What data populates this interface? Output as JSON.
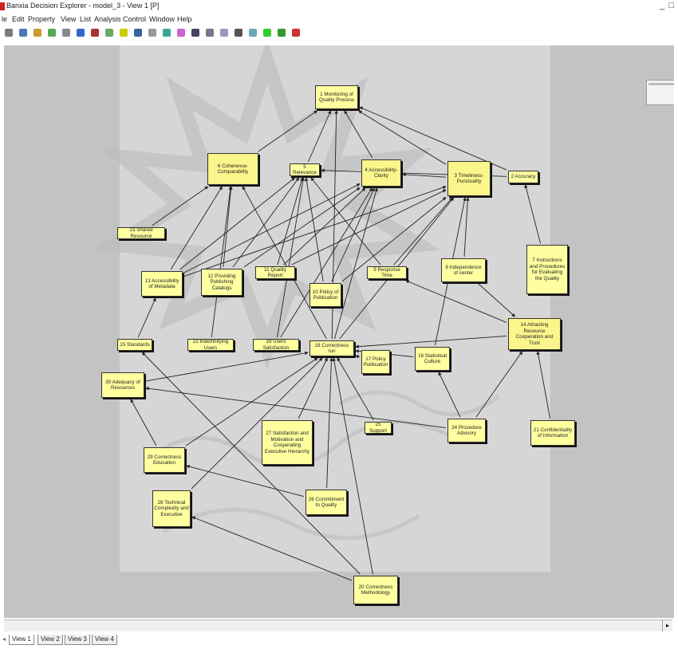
{
  "window": {
    "title": "Banxia Decision Explorer - model_3 - View 1 [P]",
    "controls": "_ □"
  },
  "menu": [
    "le",
    "Edit",
    "Property",
    "View",
    "List",
    "Analysis",
    "Control",
    "Window",
    "Help"
  ],
  "toolbar_icons": [
    "new-icon",
    "open-icon",
    "save-icon",
    "cut-icon",
    "copy-icon",
    "paste-icon",
    "link-icon",
    "style-icon",
    "run-icon",
    "map-icon",
    "print-icon",
    "help-icon",
    "view-icon",
    "layout-icon",
    "grid-icon",
    "analysis-icon",
    "list-icon",
    "zoom-icon",
    "arrow-icon",
    "node-icon",
    "shape-icon"
  ],
  "colors": {
    "node_fill": "#ffffa0",
    "canvas": "#d6d6d6",
    "workspace": "#c3c3c3"
  },
  "tabs": [
    {
      "label": "View 1",
      "active": true
    },
    {
      "label": "View 2",
      "active": false
    },
    {
      "label": "View 3",
      "active": false
    },
    {
      "label": "View 4",
      "active": false
    }
  ],
  "nodes": [
    {
      "id": "n1",
      "label": "1 Monitoring of Quality Process"
    },
    {
      "id": "n6",
      "label": "6 Coherence-Comparability"
    },
    {
      "id": "n5",
      "label": "5 Relevance"
    },
    {
      "id": "n4",
      "label": "4 Accessibility-Clarity"
    },
    {
      "id": "n3",
      "label": "3 Timeliness-Punctuality"
    },
    {
      "id": "n2",
      "label": "2 Accuracy"
    },
    {
      "id": "n23",
      "label": "23 Shared Resource"
    },
    {
      "id": "n7",
      "label": "7 Instructions and Procedures for Evaluating the Quality"
    },
    {
      "id": "n13",
      "label": "13 Accessibility of Metadata"
    },
    {
      "id": "n12",
      "label": "12 Providing Publishing Catalogs"
    },
    {
      "id": "n11",
      "label": "11 Quality Report"
    },
    {
      "id": "n10",
      "label": "10 Policy of Publication"
    },
    {
      "id": "n9",
      "label": "9 Response Time"
    },
    {
      "id": "n8",
      "label": "8 Independence of center"
    },
    {
      "id": "n14",
      "label": "14 Attracting Resource Cooperation and Trust"
    },
    {
      "id": "n15",
      "label": "15 Standards"
    },
    {
      "id": "n22",
      "label": "22 Indemnifying Users"
    },
    {
      "id": "n19",
      "label": "19 Users Satisfaction"
    },
    {
      "id": "n18",
      "label": "18 Correctness run"
    },
    {
      "id": "n17",
      "label": "17 Policy Publication"
    },
    {
      "id": "n16",
      "label": "16 Statistical Culture"
    },
    {
      "id": "n30",
      "label": "30 Adequacy of Resources"
    },
    {
      "id": "n27",
      "label": "27 Satisfaction and Motivation and Cooperating Executive Hierarchy"
    },
    {
      "id": "n25",
      "label": "25 Support"
    },
    {
      "id": "n24",
      "label": "24 Procedure Advisory"
    },
    {
      "id": "n21",
      "label": "21 Confidentiality of Information"
    },
    {
      "id": "n29",
      "label": "29 Correctness Education"
    },
    {
      "id": "n28",
      "label": "28 Technical Complexity and Executive"
    },
    {
      "id": "n26",
      "label": "26 Commitment to Quality"
    },
    {
      "id": "n20",
      "label": "20 Correctness Methodology"
    }
  ],
  "links": [
    [
      "n6",
      "n1"
    ],
    [
      "n5",
      "n1"
    ],
    [
      "n4",
      "n1"
    ],
    [
      "n3",
      "n1"
    ],
    [
      "n2",
      "n1"
    ],
    [
      "n23",
      "n6"
    ],
    [
      "n13",
      "n6"
    ],
    [
      "n13",
      "n5"
    ],
    [
      "n13",
      "n4"
    ],
    [
      "n13",
      "n3"
    ],
    [
      "n12",
      "n6"
    ],
    [
      "n12",
      "n5"
    ],
    [
      "n12",
      "n4"
    ],
    [
      "n11",
      "n5"
    ],
    [
      "n11",
      "n4"
    ],
    [
      "n11",
      "n3"
    ],
    [
      "n10",
      "n5"
    ],
    [
      "n10",
      "n4"
    ],
    [
      "n10",
      "n3"
    ],
    [
      "n9",
      "n5"
    ],
    [
      "n9",
      "n3"
    ],
    [
      "n8",
      "n3"
    ],
    [
      "n8",
      "n14"
    ],
    [
      "n7",
      "n2"
    ],
    [
      "n15",
      "n13"
    ],
    [
      "n22",
      "n6"
    ],
    [
      "n19",
      "n5"
    ],
    [
      "n19",
      "n4"
    ],
    [
      "n18",
      "n1"
    ],
    [
      "n18",
      "n6"
    ],
    [
      "n18",
      "n4"
    ],
    [
      "n18",
      "n3"
    ],
    [
      "n17",
      "n18"
    ],
    [
      "n16",
      "n18"
    ],
    [
      "n16",
      "n3"
    ],
    [
      "n14",
      "n18"
    ],
    [
      "n14",
      "n9"
    ],
    [
      "n21",
      "n14"
    ],
    [
      "n24",
      "n14"
    ],
    [
      "n24",
      "n30"
    ],
    [
      "n30",
      "n18"
    ],
    [
      "n27",
      "n18"
    ],
    [
      "n25",
      "n18"
    ],
    [
      "n29",
      "n18"
    ],
    [
      "n29",
      "n30"
    ],
    [
      "n28",
      "n18"
    ],
    [
      "n26",
      "n18"
    ],
    [
      "n26",
      "n29"
    ],
    [
      "n20",
      "n18"
    ],
    [
      "n20",
      "n15"
    ],
    [
      "n20",
      "n28"
    ],
    [
      "n24",
      "n16"
    ],
    [
      "n3",
      "n4"
    ],
    [
      "n2",
      "n5"
    ]
  ]
}
